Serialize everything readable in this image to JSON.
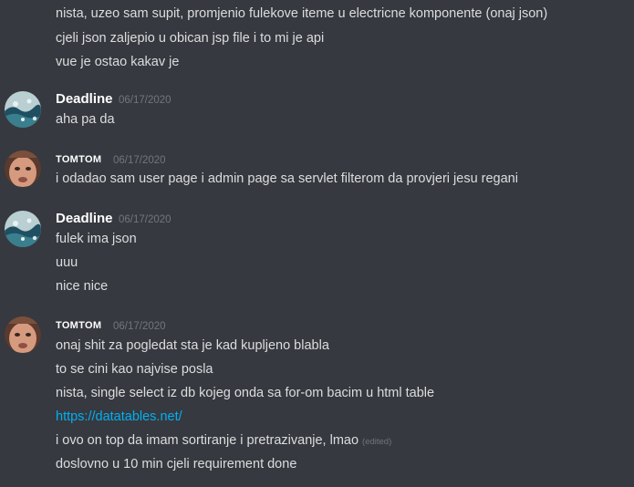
{
  "messages": {
    "m0": {
      "lines": [
        "nista, uzeo sam supit, promjenio fulekove iteme u electricne komponente (onaj json)",
        "cjeli json zaljepio u obican jsp file i to mi je api",
        "vue je ostao kakav je"
      ]
    },
    "m1": {
      "author": "Deadline",
      "timestamp": "06/17/2020",
      "lines": [
        "aha pa da"
      ]
    },
    "m2": {
      "author": "TOMTOM",
      "timestamp": "06/17/2020",
      "lines": [
        "i odadao sam user page i admin page sa servlet filterom da provjeri jesu regani"
      ]
    },
    "m3": {
      "author": "Deadline",
      "timestamp": "06/17/2020",
      "lines": [
        "fulek ima json",
        "uuu",
        "nice nice"
      ]
    },
    "m4": {
      "author": "TOMTOM",
      "timestamp": "06/17/2020",
      "lines": [
        "onaj shit za pogledat sta je kad kupljeno blabla",
        "to se cini kao najvise posla",
        "nista, single select iz db kojeg onda sa for-om bacim u html table",
        "https://datatables.net/",
        "i ovo on top da imam sortiranje i pretrazivanje, lmao",
        "doslovno u 10 min cjeli requirement done"
      ],
      "edited_label": "(edited)"
    }
  },
  "colors": {
    "background": "#36393f",
    "text": "#dcddde",
    "muted": "#72767d",
    "link": "#00b0f4"
  }
}
